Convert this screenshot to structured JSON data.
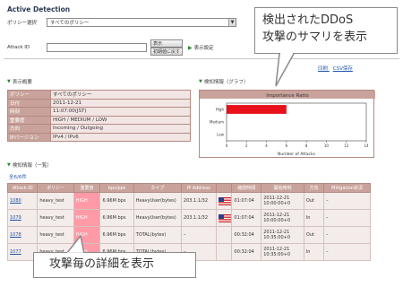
{
  "title": "Active Detection",
  "controls": {
    "policy_label": "ポリシー選択",
    "policy_value": "すべてのポリシー",
    "attack_id_label": "Attack ID",
    "display_button": "表示",
    "reset_button": "初期値に戻す",
    "display_settings": "表示設定"
  },
  "summary": {
    "section_title": "表示概要",
    "rows": [
      {
        "key": "ポリシー",
        "value": "すべてのポリシー"
      },
      {
        "key": "日付",
        "value": "2011-12-21"
      },
      {
        "key": "時刻",
        "value": "11:07:00(JST)"
      },
      {
        "key": "重要度",
        "value": "HIGH / MEDIUM / LOW"
      },
      {
        "key": "方向",
        "value": "Incoming / Outgoing"
      },
      {
        "key": "IPバージョン",
        "value": "IPv4 / IPv6"
      }
    ]
  },
  "links": {
    "print": "印刷",
    "csv": "CSV保存"
  },
  "graph": {
    "section_title": "検知情報（グラフ）"
  },
  "chart_data": {
    "type": "bar",
    "title": "Importance Ratio",
    "xlabel": "Number of Attacks",
    "ylabel": "",
    "orientation": "horizontal",
    "categories": [
      "High",
      "Medium",
      "Low"
    ],
    "values": [
      6,
      0,
      0
    ],
    "xlim": [
      0,
      14
    ],
    "xticks": [
      "0",
      "2",
      "4",
      "6",
      "8",
      "10",
      "12",
      "14"
    ],
    "bar_color": "#e8101a",
    "grid": false
  },
  "list": {
    "section_title": "検知情報（一覧）",
    "count_label": "全6/6件",
    "columns": [
      "Attack ID",
      "ポリシー",
      "重要度",
      "bps/pps",
      "タイプ",
      "IP Address",
      "",
      "継続時間",
      "開始時刻",
      "方向",
      "Mitigation状況"
    ],
    "rows": [
      {
        "id": "1080",
        "policy": "heavy_test",
        "severity": "HIGH",
        "rate": "6.96M bps",
        "type": "HeavyUser(bytes)",
        "ip": "203.1.1/32",
        "flag": "us",
        "duration": "01:07:04",
        "start_date": "2011-12-21",
        "start_time": "10:00:00+0",
        "dir": "Out",
        "mitigation": "–"
      },
      {
        "id": "1079",
        "policy": "heavy_test",
        "severity": "HIGH",
        "rate": "6.96M bps",
        "type": "HeavyUser(bytes)",
        "ip": "203.1.1/32",
        "flag": "us",
        "duration": "01:07:04",
        "start_date": "2011-12-21",
        "start_time": "10:00:00+0",
        "dir": "In",
        "mitigation": "–"
      },
      {
        "id": "1078",
        "policy": "heavy_test",
        "severity": "HIGH",
        "rate": "6.96M bps",
        "type": "TOTAL(bytes)",
        "ip": "–",
        "flag": "",
        "duration": "00:32:04",
        "start_date": "2011-12-21",
        "start_time": "10:35:00+0",
        "dir": "Out",
        "mitigation": "–"
      },
      {
        "id": "1077",
        "policy": "heavy_test",
        "severity": "HIGH",
        "rate": "6.96M bps",
        "type": "TOTAL(bytes)",
        "ip": "–",
        "flag": "",
        "duration": "00:32:04",
        "start_date": "2011-12-21",
        "start_time": "10:35:00+0",
        "dir": "In",
        "mitigation": "–"
      }
    ]
  },
  "callouts": {
    "top_line1": "検出されたDDoS",
    "top_line2": "攻撃のサマリを表示",
    "bottom": "攻撃毎の詳細を表示"
  },
  "colors": {
    "header": "#c9a39b",
    "severity_high": "#ff9aa6",
    "link": "#2255aa",
    "bar": "#e8101a"
  }
}
